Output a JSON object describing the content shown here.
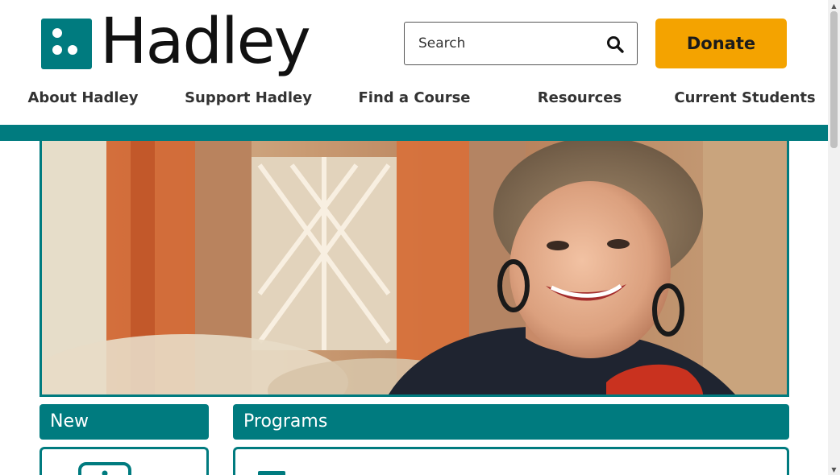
{
  "header": {
    "logo_text": "Hadley",
    "search": {
      "placeholder": "Search",
      "value": ""
    },
    "donate_label": "Donate"
  },
  "nav": {
    "items": [
      {
        "label": "About Hadley"
      },
      {
        "label": "Support Hadley"
      },
      {
        "label": "Find a Course"
      },
      {
        "label": "Resources"
      },
      {
        "label": "Current Students"
      }
    ]
  },
  "hero": {
    "image_icon": "hero-photo"
  },
  "panels": {
    "new": {
      "title": "New"
    },
    "programs": {
      "title": "Programs"
    }
  },
  "colors": {
    "brand_teal": "#007b7f",
    "donate_gold": "#f4a300"
  }
}
